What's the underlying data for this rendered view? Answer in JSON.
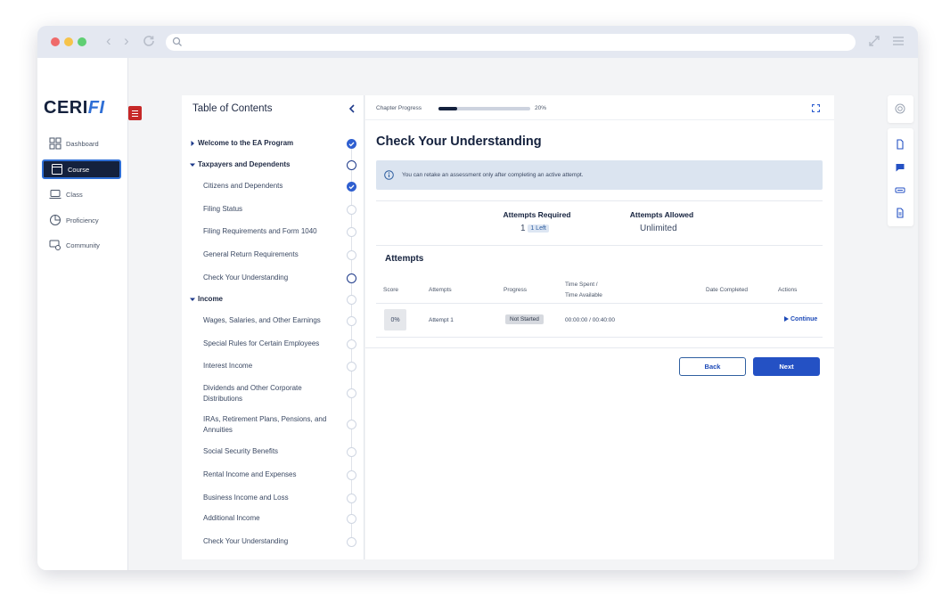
{
  "browser": {
    "traffic_colors": [
      "#ef6a6a",
      "#f6c34a",
      "#5fcf73"
    ],
    "back_glyph": "‹",
    "forward_glyph": "›",
    "icons": [
      "reload-icon",
      "search-icon",
      "expand-icon",
      "menu-icon"
    ]
  },
  "sidebar": {
    "logo_main": "CERI",
    "logo_accent": "FI",
    "items": [
      {
        "label": "Dashboard",
        "icon": "dashboard-icon",
        "active": false
      },
      {
        "label": "Course",
        "icon": "course-icon",
        "active": true
      },
      {
        "label": "Class",
        "icon": "class-icon",
        "active": false
      },
      {
        "label": "Proficiency",
        "icon": "proficiency-icon",
        "active": false
      },
      {
        "label": "Community",
        "icon": "community-icon",
        "active": false
      }
    ]
  },
  "toc": {
    "title": "Table of Contents",
    "rows": [
      {
        "label": "Welcome to the EA Program",
        "type": "section",
        "expanded": false,
        "status": "done"
      },
      {
        "label": "Taxpayers and Dependents",
        "type": "section",
        "expanded": true,
        "status": "current"
      },
      {
        "label": "Citizens and Dependents",
        "type": "item",
        "status": "done"
      },
      {
        "label": "Filing Status",
        "type": "item",
        "status": "todo"
      },
      {
        "label": "Filing Requirements and Form 1040",
        "type": "item",
        "status": "todo"
      },
      {
        "label": "General Return Requirements",
        "type": "item",
        "status": "todo"
      },
      {
        "label": "Check Your Understanding",
        "type": "item",
        "status": "current"
      },
      {
        "label": "Income",
        "type": "section",
        "expanded": true,
        "status": "todo"
      },
      {
        "label": "Wages, Salaries, and Other Earnings",
        "type": "item",
        "status": "todo"
      },
      {
        "label": "Special Rules for Certain Employees",
        "type": "item",
        "status": "todo"
      },
      {
        "label": "Interest Income",
        "type": "item",
        "status": "todo"
      },
      {
        "label": "Dividends and Other Corporate Distributions",
        "type": "item",
        "status": "todo"
      },
      {
        "label": "IRAs, Retirement Plans, Pensions, and Annuities",
        "type": "item",
        "status": "todo"
      },
      {
        "label": "Social Security Benefits",
        "type": "item",
        "status": "todo"
      },
      {
        "label": "Rental Income and Expenses",
        "type": "item",
        "status": "todo"
      },
      {
        "label": "Business Income and Loss",
        "type": "item",
        "status": "todo"
      },
      {
        "label": "Additional Income",
        "type": "item",
        "status": "todo"
      },
      {
        "label": "Check Your Understanding",
        "type": "item",
        "status": "todo"
      }
    ]
  },
  "progress": {
    "label": "Chapter Progress",
    "percent_text": "20%",
    "fraction": 0.2
  },
  "main": {
    "title": "Check Your Understanding",
    "info_text": "You can retake an assessment only after completing an active attempt.",
    "attempts_required_label": "Attempts Required",
    "attempts_required_value": "1",
    "attempts_left": "1 Left",
    "attempts_allowed_label": "Attempts Allowed",
    "attempts_allowed_value": "Unlimited",
    "attempts_title": "Attempts",
    "columns": {
      "score": "Score",
      "attempts": "Attempts",
      "progress": "Progress",
      "time_line1": "Time Spent /",
      "time_line2": "Time Available",
      "date": "Date Completed",
      "actions": "Actions"
    },
    "row": {
      "score": "0%",
      "attempt": "Attempt 1",
      "progress": "Not Started",
      "time": "00:00:00 / 00:40:00",
      "date": "",
      "action": "Continue"
    },
    "back_label": "Back",
    "next_label": "Next"
  },
  "right_tools": [
    "support-icon",
    "document-icon",
    "chat-icon",
    "caption-icon",
    "notes-icon"
  ],
  "colors": {
    "brand_navy": "#14213d",
    "accent_blue": "#2451c4",
    "danger_red": "#c62828"
  }
}
